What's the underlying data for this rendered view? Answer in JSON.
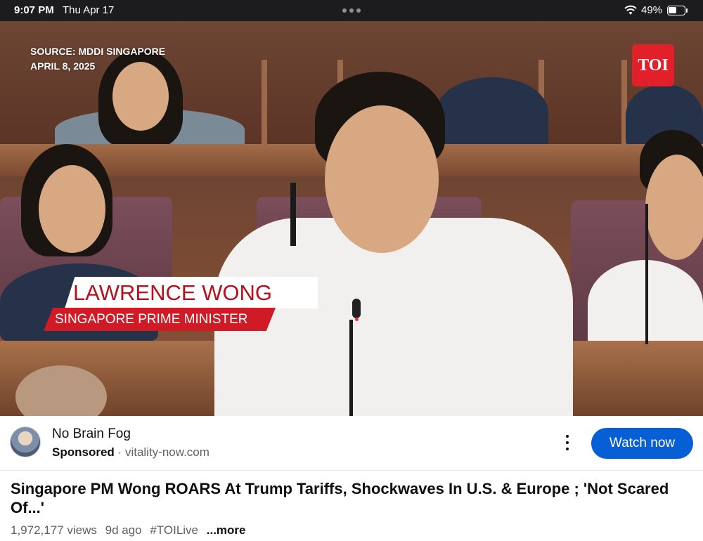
{
  "status_bar": {
    "time": "9:07 PM",
    "date": "Thu Apr 17",
    "battery_percent": "49%",
    "battery_level": 0.49
  },
  "video": {
    "source_line1": "SOURCE: MDDI SINGAPORE",
    "source_line2": "APRIL 8, 2025",
    "channel_logo": "TOI",
    "lower_third_name": "LAWRENCE WONG",
    "lower_third_title": "SINGAPORE PRIME MINISTER"
  },
  "ad": {
    "title": "No Brain Fog",
    "sponsored_label": "Sponsored",
    "separator": "·",
    "domain": "vitality-now.com",
    "cta_label": "Watch now",
    "cta_color": "#065fd4"
  },
  "details": {
    "title": "Singapore PM Wong ROARS At Trump Tariffs, Shockwaves In U.S. & Europe ; 'Not Scared Of...'",
    "views": "1,972,177 views",
    "age": "9d ago",
    "hashtag": "#TOILive",
    "more_label": "...more"
  },
  "icons": [
    "wifi-icon",
    "battery-icon",
    "more-dots-icon",
    "kebab-menu-icon"
  ]
}
